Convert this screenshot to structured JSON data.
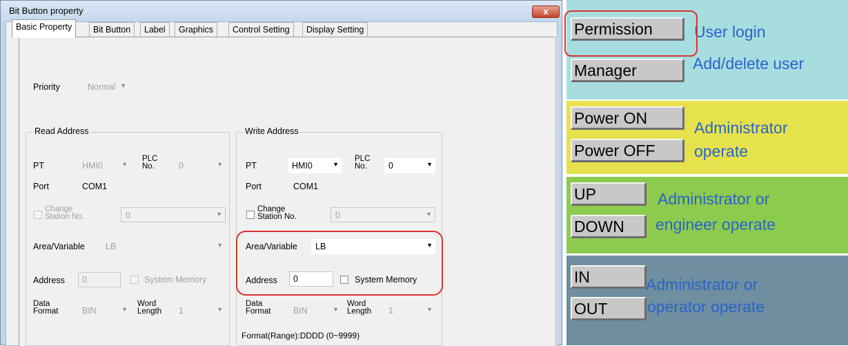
{
  "dialog": {
    "title": "Bit Button property",
    "close_label": "x",
    "tabs": [
      "Basic Property",
      "Bit Button",
      "Label",
      "Graphics",
      "Control Setting",
      "Display Setting"
    ],
    "priority": {
      "label": "Priority",
      "value": "Normal"
    },
    "read_address": {
      "title": "Read Address",
      "pt_label": "PT",
      "pt_value": "HMI0",
      "plc_label_1": "PLC",
      "plc_label_2": "No.",
      "plc_value": "0",
      "port_label": "Port",
      "port_value": "COM1",
      "change_label_1": "Change",
      "change_label_2": "Station No.",
      "change_value": "0",
      "area_label": "Area/Variable",
      "area_value": "LB",
      "address_label": "Address",
      "address_value": "0",
      "system_memory_label": "System Memory",
      "data_label_1": "Data",
      "data_label_2": "Format",
      "data_value": "BIN",
      "word_label_1": "Word",
      "word_label_2": "Length",
      "word_value": "1"
    },
    "write_address": {
      "title": "Write Address",
      "pt_label": "PT",
      "pt_value": "HMI0",
      "plc_label_1": "PLC",
      "plc_label_2": "No.",
      "plc_value": "0",
      "port_label": "Port",
      "port_value": "COM1",
      "change_label_1": "Change",
      "change_label_2": "Station No.",
      "change_value": "0",
      "area_label": "Area/Variable",
      "area_value": "LB",
      "address_label": "Address",
      "address_value": "0",
      "system_memory_label": "System Memory",
      "data_label_1": "Data",
      "data_label_2": "Format",
      "data_value": "BIN",
      "word_label_1": "Word",
      "word_label_2": "Length",
      "word_value": "1",
      "format_range": "Format(Range):DDDD (0~9999)"
    }
  },
  "hmi": {
    "sections": [
      {
        "color": "#a8dde0",
        "buttons": [
          "Permission",
          "Manager"
        ],
        "desc": [
          "User login",
          "Add/delete user"
        ]
      },
      {
        "color": "#e6e24e",
        "buttons": [
          "Power ON",
          "Power OFF"
        ],
        "desc": [
          "Administrator",
          "operate"
        ]
      },
      {
        "color": "#8ccb4d",
        "buttons": [
          "UP",
          "DOWN"
        ],
        "desc": [
          "Administrator or",
          "engineer operate"
        ]
      },
      {
        "color": "#6f8fa0",
        "buttons": [
          "IN",
          "OUT"
        ],
        "desc": [
          "Administrator or",
          "operator operate"
        ]
      }
    ]
  }
}
